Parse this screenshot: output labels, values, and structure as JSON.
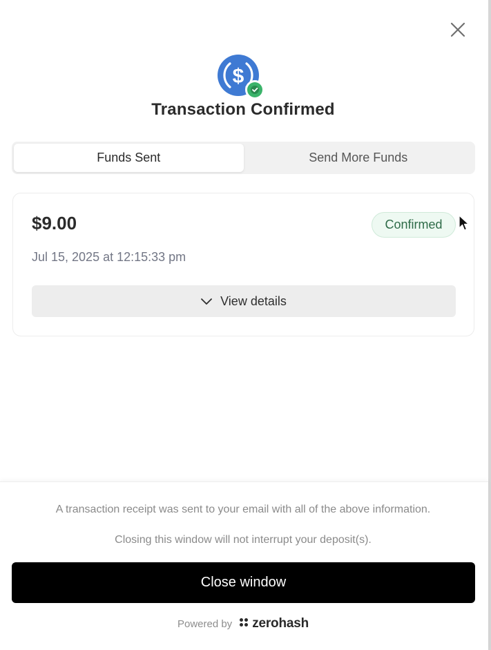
{
  "dialog": {
    "title": "Transaction Confirmed",
    "close_icon": "close-icon",
    "hero_icon": "usdc-dollar-icon",
    "check_icon": "check-badge-icon"
  },
  "tabs": [
    {
      "label": "Funds Sent",
      "active": true
    },
    {
      "label": "Send More Funds",
      "active": false
    }
  ],
  "transaction": {
    "amount": "$9.00",
    "status": "Confirmed",
    "date": "Jul 15, 2025 at 12:15:33 pm",
    "details_label": "View details",
    "details_icon": "chevron-down-icon"
  },
  "footer": {
    "receipt_note": "A transaction receipt was sent to your email with all of the above information.",
    "closing_note": "Closing this window will not interrupt your deposit(s).",
    "close_button": "Close window",
    "powered_by": "Powered by",
    "brand_name": "zerohash",
    "brand_icon": "zerohash-logo-icon"
  },
  "colors": {
    "accent_blue": "#3f7ad3",
    "success_green": "#3bb36a",
    "badge_bg": "#eef9f2",
    "badge_text": "#2e6b48",
    "primary_button": "#000000"
  }
}
